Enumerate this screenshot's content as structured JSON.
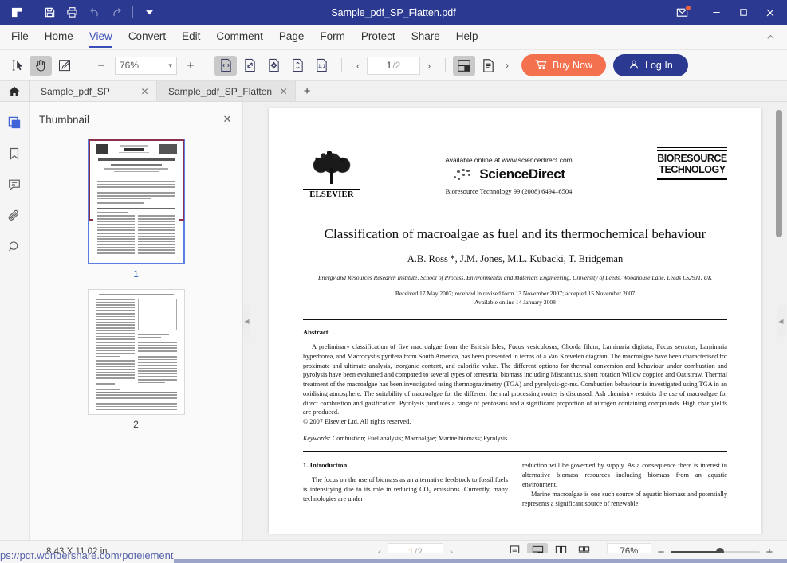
{
  "window": {
    "title": "Sample_pdf_SP_Flatten.pdf",
    "quick_access": [
      "logo-icon",
      "save-icon",
      "print-icon",
      "undo-icon",
      "redo-icon",
      "customize-dropdown-icon"
    ],
    "controls": {
      "mail_icon": "envelope-icon",
      "minimize": "—",
      "maximize": "□",
      "close": "✕"
    }
  },
  "menubar": {
    "items": [
      {
        "label": "File",
        "active": false
      },
      {
        "label": "Home",
        "active": false
      },
      {
        "label": "View",
        "active": true
      },
      {
        "label": "Convert",
        "active": false
      },
      {
        "label": "Edit",
        "active": false
      },
      {
        "label": "Comment",
        "active": false
      },
      {
        "label": "Page",
        "active": false
      },
      {
        "label": "Form",
        "active": false
      },
      {
        "label": "Protect",
        "active": false
      },
      {
        "label": "Share",
        "active": false
      },
      {
        "label": "Help",
        "active": false
      }
    ],
    "collapse_icon": "chevron-up-icon"
  },
  "toolbar": {
    "select_tool": "select-text-icon",
    "hand_tool": "hand-icon",
    "markup_tool": "edit-annotate-icon",
    "zoom_out": "−",
    "zoom_value": "76%",
    "zoom_in": "+",
    "fit_width": "fit-width-icon",
    "fit_page": "fit-page-icon",
    "fit_visible": "fit-visible-icon",
    "fit_height": "fit-height-icon",
    "actual_size": "1:1",
    "prev_page": "‹",
    "page_current": "1",
    "page_total": "/2",
    "next_page": "›",
    "view_split": "split-view-icon",
    "view_single": "single-page-icon",
    "more": "›",
    "buy_label": "Buy Now",
    "buy_icon": "cart-icon",
    "login_label": "Log In",
    "login_icon": "user-icon",
    "buy_color": "#f4714f",
    "login_color": "#2b3990"
  },
  "tabs": {
    "home_icon": "home-icon",
    "items": [
      {
        "label": "Sample_pdf_SP",
        "active": false
      },
      {
        "label": "Sample_pdf_SP_Flatten",
        "active": true
      }
    ],
    "close_icon": "✕",
    "new_tab": "+"
  },
  "rail": {
    "items": [
      {
        "name": "thumbnail-icon",
        "active": true
      },
      {
        "name": "bookmark-icon",
        "active": false
      },
      {
        "name": "comment-icon",
        "active": false
      },
      {
        "name": "attachment-icon",
        "active": false
      },
      {
        "name": "search-icon",
        "active": false
      }
    ],
    "active_color": "#4062d8"
  },
  "thumbnail_panel": {
    "title": "Thumbnail",
    "close": "✕",
    "pages": [
      {
        "label": "1",
        "selected": true
      },
      {
        "label": "2",
        "selected": false
      }
    ],
    "selection_color": "#8b2f4a",
    "active_border_color": "#5b7fe0"
  },
  "document": {
    "publisher": "ELSEVIER",
    "available_online": "Available online at www.sciencedirect.com",
    "sciencedirect": "ScienceDirect",
    "citation": "Bioresource Technology 99 (2008) 6494–6504",
    "journal_line1": "BIORESOURCE",
    "journal_line2": "TECHNOLOGY",
    "title": "Classification of macroalgae as fuel and its thermochemical behaviour",
    "authors": "A.B. Ross *, J.M. Jones, M.L. Kubacki, T. Bridgeman",
    "affiliation": "Energy and Resources Research Institute, School of Process, Environmental and Materials Engineering, University of Leeds, Woodhouse Lane, Leeds LS29JT, UK",
    "received": "Received 17 May 2007; received in revised form 13 November 2007; accepted 15 November 2007",
    "available": "Available online 14 January 2008",
    "abstract_heading": "Abstract",
    "abstract_body": "A preliminary classification of five macroalgae from the British Isles; Fucus vesiculosus, Chorda filum, Laminaria digitata, Fucus serratus, Laminaria hyperborea, and Macrocystis pyrifera from South America, has been presented in terms of a Van Krevelen diagram. The macroalgae have been characterised for proximate and ultimate analysis, inorganic content, and calorific value. The different options for thermal conversion and behaviour under combustion and pyrolysis have been evaluated and compared to several types of terrestrial biomass including Miscanthus, short rotation Willow coppice and Oat straw. Thermal treatment of the macroalgae has been investigated using thermogravimetry (TGA) and pyrolysis-gc-ms. Combustion behaviour is investigated using TGA in an oxidising atmosphere. The suitability of macroalgae for the different thermal processing routes is discussed. Ash chemistry restricts the use of macroalgae for direct combustion and gasification. Pyrolysis produces a range of pentosans and a significant proportion of nitrogen containing compounds. High char yields are produced.",
    "copyright": "© 2007 Elsevier Ltd. All rights reserved.",
    "keywords_label": "Keywords:",
    "keywords_value": "Combustion; Fuel analysis; Macroalgae; Marine biomass; Pyrolysis",
    "section_heading": "1. Introduction",
    "col_left": "The focus on the use of biomass as an alternative feedstock to fossil fuels is intensifying due to its role in reducing CO₂ emissions. Currently, many technologies are under",
    "col_right_1": "reduction will be governed by supply. As a consequence there is interest in alternative biomass resources including biomass from an aquatic environment.",
    "col_right_2": "Marine macroalgae is one such source of aquatic biomass and potentially represents a significant source of renewable"
  },
  "statusbar": {
    "page_size": "8.43 X 11.02 in",
    "prev": "‹",
    "page_current": "1",
    "page_total": "/2",
    "next": "›",
    "view_modes": [
      {
        "name": "continuous-view-icon",
        "selected": false
      },
      {
        "name": "facing-view-icon",
        "selected": true
      },
      {
        "name": "two-page-view-icon",
        "selected": false
      },
      {
        "name": "grid-view-icon",
        "selected": false
      }
    ],
    "zoom_value": "76%",
    "zoom_out": "−",
    "zoom_in": "+"
  },
  "overlay": {
    "url_text": "ps://pdf.wondershare.com/pdfelement"
  }
}
